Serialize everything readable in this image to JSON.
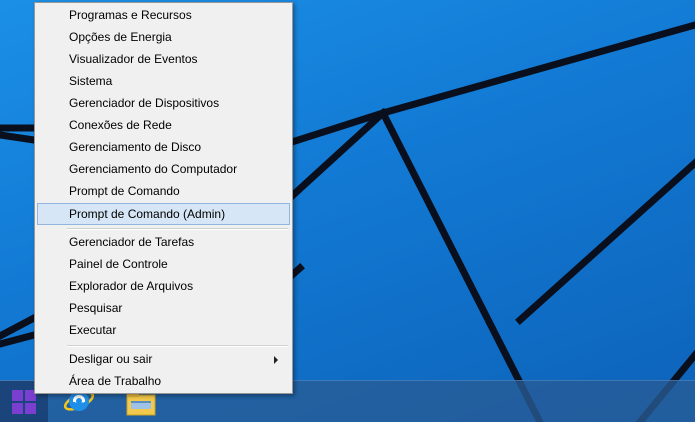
{
  "context_menu": {
    "group_1": [
      {
        "label": "Programas e Recursos"
      },
      {
        "label": "Opções de Energia"
      },
      {
        "label": "Visualizador de Eventos"
      },
      {
        "label": "Sistema"
      },
      {
        "label": "Gerenciador de Dispositivos"
      },
      {
        "label": "Conexões de Rede"
      },
      {
        "label": "Gerenciamento de Disco"
      },
      {
        "label": "Gerenciamento do Computador"
      },
      {
        "label": "Prompt de Comando"
      },
      {
        "label": "Prompt de Comando (Admin)",
        "selected": true
      }
    ],
    "group_2": [
      {
        "label": "Gerenciador de Tarefas"
      },
      {
        "label": "Painel de Controle"
      },
      {
        "label": "Explorador de Arquivos"
      },
      {
        "label": "Pesquisar"
      },
      {
        "label": "Executar"
      }
    ],
    "group_3": [
      {
        "label": "Desligar ou sair",
        "has_submenu": true
      },
      {
        "label": "Área de Trabalho"
      }
    ]
  },
  "taskbar": {
    "start_icon": "windows-logo-icon",
    "pinned": [
      {
        "icon": "internet-explorer-icon"
      },
      {
        "icon": "file-explorer-icon"
      }
    ]
  },
  "colors": {
    "desktop_blue": "#1279d3",
    "menu_background": "#f0f0f0",
    "selected_background": "#d6e6f6",
    "selected_border": "#93b6de",
    "start_logo": "#7a3fd0"
  }
}
